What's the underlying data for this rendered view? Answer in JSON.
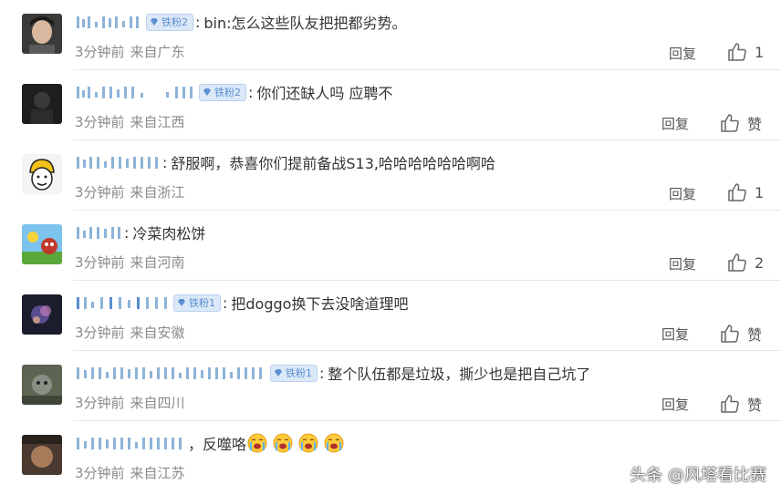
{
  "colors": {
    "badge_text": "#5b8fd0",
    "meta_text": "#8a8a8a",
    "body_text": "#333333",
    "divider": "#e8e8e8"
  },
  "icons": {
    "badge": "diamond-gem-icon",
    "like": "thumbs-up-outline-icon"
  },
  "comments": [
    {
      "badge": "铁粉2",
      "text": "bin:怎么这些队友把把都劣势。",
      "time": "3分钟前",
      "location": "来自广东",
      "reply": "回复",
      "like_label": "1"
    },
    {
      "badge": "铁粉2",
      "text": "你们还缺人吗 应聘不",
      "time": "3分钟前",
      "location": "来自江西",
      "reply": "回复",
      "like_label": "赞"
    },
    {
      "badge": "",
      "text": "舒服啊，恭喜你们提前备战S13,哈哈哈哈哈哈啊哈",
      "time": "3分钟前",
      "location": "来自浙江",
      "reply": "回复",
      "like_label": "1"
    },
    {
      "badge": "",
      "text": "冷菜肉松饼",
      "time": "3分钟前",
      "location": "来自河南",
      "reply": "回复",
      "like_label": "2"
    },
    {
      "badge": "铁粉1",
      "text": "把doggo换下去没啥道理吧",
      "time": "3分钟前",
      "location": "来自安徽",
      "reply": "回复",
      "like_label": "赞"
    },
    {
      "badge": "铁粉1",
      "text": "整个队伍都是垃圾，撕少也是把自己坑了",
      "time": "3分钟前",
      "location": "来自四川",
      "reply": "回复",
      "like_label": "赞"
    },
    {
      "badge": "",
      "text": "，反噬咯",
      "time": "3分钟前",
      "location": "来自江苏",
      "reply": "",
      "like_label": ""
    }
  ],
  "watermark": "头条 @风塔看比赛"
}
